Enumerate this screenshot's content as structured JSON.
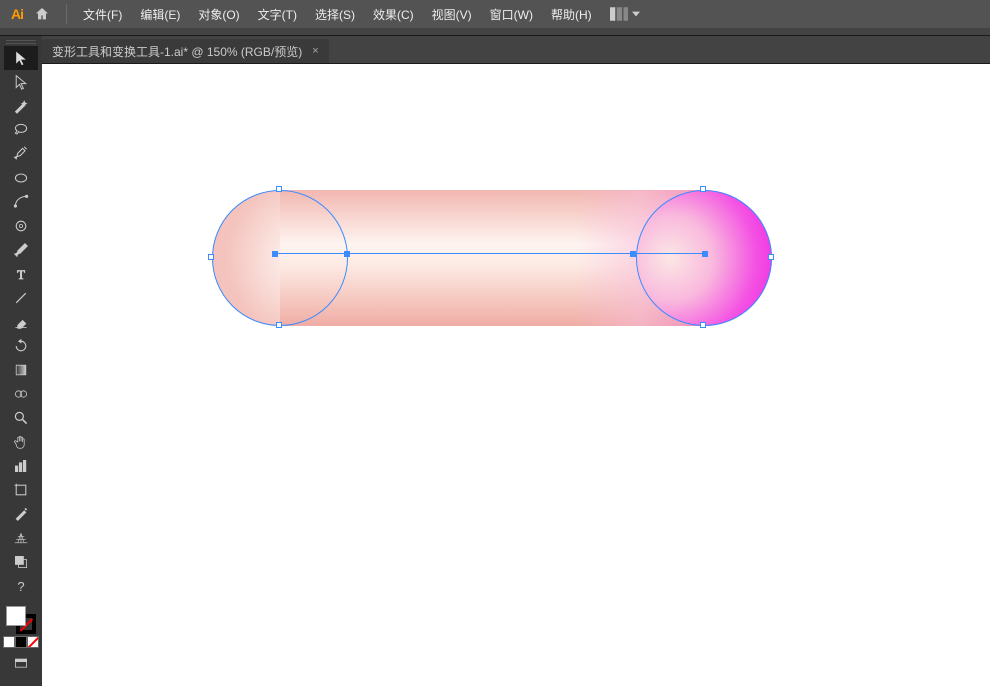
{
  "app": {
    "logo": "Ai"
  },
  "menu": {
    "file": "文件(F)",
    "edit": "编辑(E)",
    "object": "对象(O)",
    "type": "文字(T)",
    "select": "选择(S)",
    "effect": "效果(C)",
    "view": "视图(V)",
    "window": "窗口(W)",
    "help": "帮助(H)"
  },
  "tab": {
    "title": "变形工具和变换工具-1.ai* @ 150% (RGB/预览)",
    "close": "×"
  },
  "tools": {
    "selection": "selection",
    "directSelect": "direct-selection",
    "pen": "pen",
    "curvature": "curvature",
    "line": "line",
    "ellipse": "ellipse",
    "brush": "brush",
    "shaper": "shaper",
    "pencil": "pencil",
    "type": "type",
    "rotate": "rotate",
    "reflect": "reflect",
    "width": "width",
    "gradient": "gradient",
    "eyedropper": "eyedropper",
    "blend": "blend",
    "zoom": "zoom",
    "hand": "hand",
    "graph": "graph",
    "artboard": "artboard",
    "slice": "slice",
    "perspective": "perspective"
  },
  "help_char": "?",
  "canvas": {
    "zoom": "150%",
    "mode": "RGB/预览"
  }
}
